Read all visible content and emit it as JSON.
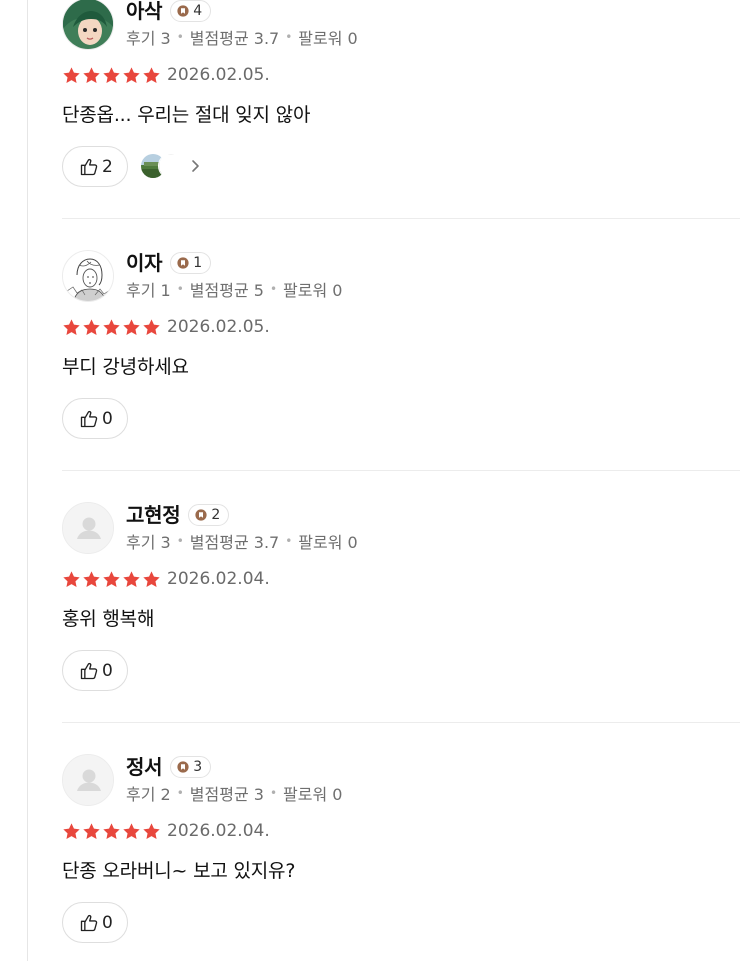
{
  "colors": {
    "star": "#e8473d",
    "badge_brown": "#9a6a4c",
    "text_muted": "#6f6f6f"
  },
  "reviews": [
    {
      "name": "아삭",
      "badge_level": "4",
      "meta": {
        "reviews": "후기 3",
        "avg": "별점평균 3.7",
        "followers": "팔로워 0"
      },
      "rating": 5,
      "date": "2026.02.05.",
      "text": "단종옵... 우리는 절대 잊지 않아",
      "likes": "2",
      "avatar_icon": "green-hair-character-avatar",
      "has_likers": true
    },
    {
      "name": "이자",
      "badge_level": "1",
      "meta": {
        "reviews": "후기 1",
        "avg": "별점평균 5",
        "followers": "팔로워 0"
      },
      "rating": 5,
      "date": "2026.02.05.",
      "text": "부디 강녕하세요",
      "likes": "0",
      "avatar_icon": "sketch-portrait-avatar",
      "has_likers": false
    },
    {
      "name": "고현정",
      "badge_level": "2",
      "meta": {
        "reviews": "후기 3",
        "avg": "별점평균 3.7",
        "followers": "팔로워 0"
      },
      "rating": 5,
      "date": "2026.02.04.",
      "text": "홍위 행복해",
      "likes": "0",
      "avatar_icon": "default-user-avatar",
      "has_likers": false
    },
    {
      "name": "정서",
      "badge_level": "3",
      "meta": {
        "reviews": "후기 2",
        "avg": "별점평균 3",
        "followers": "팔로워 0"
      },
      "rating": 5,
      "date": "2026.02.04.",
      "text": "단종 오라버니~ 보고 있지유?",
      "likes": "0",
      "avatar_icon": "default-user-avatar",
      "has_likers": false
    }
  ]
}
